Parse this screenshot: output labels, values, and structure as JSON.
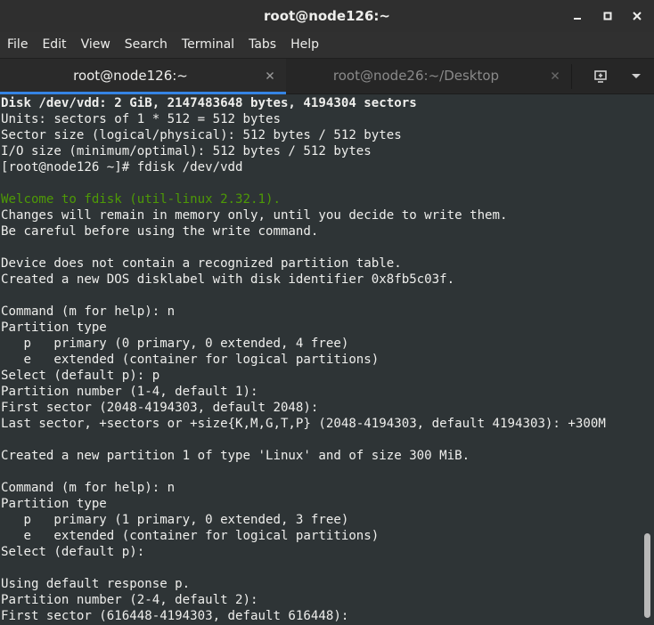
{
  "window": {
    "title": "root@node126:~",
    "controls": [
      "minimize-icon",
      "maximize-icon",
      "close-icon"
    ]
  },
  "menubar": {
    "items": [
      "File",
      "Edit",
      "View",
      "Search",
      "Terminal",
      "Tabs",
      "Help"
    ]
  },
  "tabs": [
    {
      "label": "root@node126:~",
      "active": true
    },
    {
      "label": "root@node26:~/Desktop",
      "active": false
    }
  ],
  "tab_buttons": [
    "new-tab-icon",
    "tab-menu-chevron-icon"
  ],
  "colors": {
    "terminal_bg": "#2e3436",
    "text": "#eeeeec",
    "green": "#4e9a06",
    "tab_underline": "#3584e4"
  },
  "terminal": {
    "lines": [
      {
        "text": "Disk /dev/vdd: 2 GiB, 2147483648 bytes, 4194304 sectors",
        "style": "bold"
      },
      {
        "text": "Units: sectors of 1 * 512 = 512 bytes",
        "style": "normal"
      },
      {
        "text": "Sector size (logical/physical): 512 bytes / 512 bytes",
        "style": "normal"
      },
      {
        "text": "I/O size (minimum/optimal): 512 bytes / 512 bytes",
        "style": "normal"
      },
      {
        "text": "[root@node126 ~]# fdisk /dev/vdd",
        "style": "normal"
      },
      {
        "text": "",
        "style": "normal"
      },
      {
        "text": "Welcome to fdisk (util-linux 2.32.1).",
        "style": "green"
      },
      {
        "text": "Changes will remain in memory only, until you decide to write them.",
        "style": "normal"
      },
      {
        "text": "Be careful before using the write command.",
        "style": "normal"
      },
      {
        "text": "",
        "style": "normal"
      },
      {
        "text": "Device does not contain a recognized partition table.",
        "style": "normal"
      },
      {
        "text": "Created a new DOS disklabel with disk identifier 0x8fb5c03f.",
        "style": "normal"
      },
      {
        "text": "",
        "style": "normal"
      },
      {
        "text": "Command (m for help): n",
        "style": "normal"
      },
      {
        "text": "Partition type",
        "style": "normal"
      },
      {
        "text": "   p   primary (0 primary, 0 extended, 4 free)",
        "style": "normal"
      },
      {
        "text": "   e   extended (container for logical partitions)",
        "style": "normal"
      },
      {
        "text": "Select (default p): p",
        "style": "normal"
      },
      {
        "text": "Partition number (1-4, default 1):",
        "style": "normal"
      },
      {
        "text": "First sector (2048-4194303, default 2048):",
        "style": "normal"
      },
      {
        "text": "Last sector, +sectors or +size{K,M,G,T,P} (2048-4194303, default 4194303): +300M",
        "style": "normal"
      },
      {
        "text": "",
        "style": "normal"
      },
      {
        "text": "Created a new partition 1 of type 'Linux' and of size 300 MiB.",
        "style": "normal"
      },
      {
        "text": "",
        "style": "normal"
      },
      {
        "text": "Command (m for help): n",
        "style": "normal"
      },
      {
        "text": "Partition type",
        "style": "normal"
      },
      {
        "text": "   p   primary (1 primary, 0 extended, 3 free)",
        "style": "normal"
      },
      {
        "text": "   e   extended (container for logical partitions)",
        "style": "normal"
      },
      {
        "text": "Select (default p):",
        "style": "normal"
      },
      {
        "text": "",
        "style": "normal"
      },
      {
        "text": "Using default response p.",
        "style": "normal"
      },
      {
        "text": "Partition number (2-4, default 2):",
        "style": "normal"
      },
      {
        "text": "First sector (616448-4194303, default 616448):",
        "style": "normal"
      }
    ]
  }
}
